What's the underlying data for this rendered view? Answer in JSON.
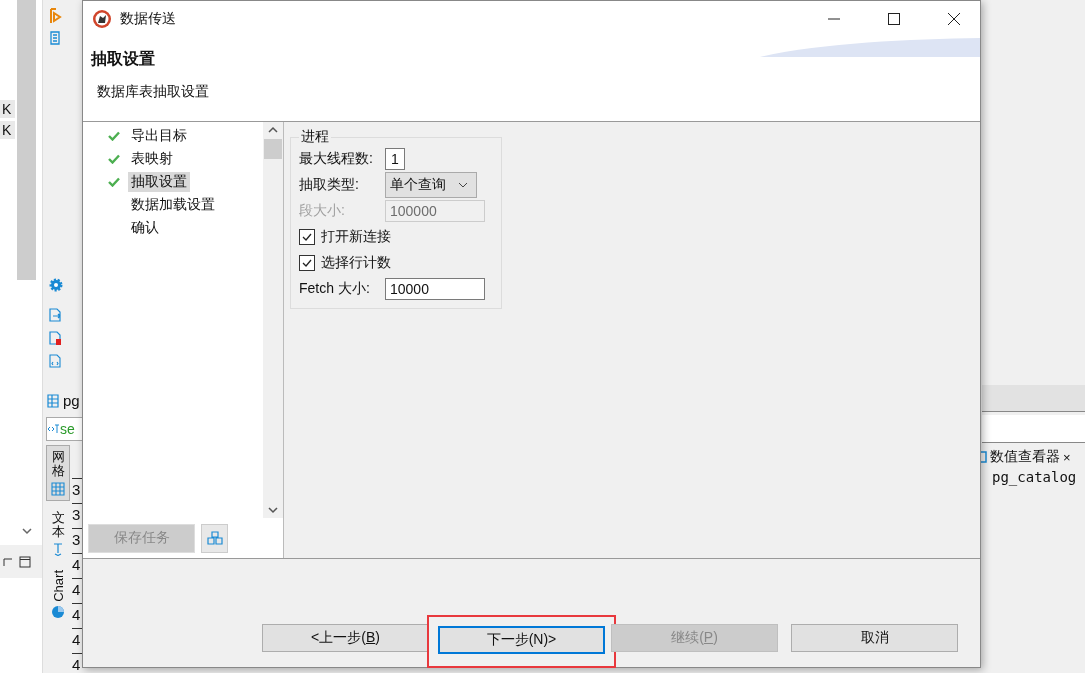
{
  "background": {
    "left_cells": [
      "K",
      "K"
    ],
    "editor_tab": "pg",
    "sql_field": "se",
    "view_tabs": [
      {
        "label": "网格",
        "kind": "grid",
        "selected": true
      },
      {
        "label": "文本",
        "kind": "text",
        "selected": false
      },
      {
        "label": "Chart",
        "kind": "chart",
        "selected": false
      }
    ],
    "row_numbers": [
      "3",
      "3",
      "3",
      "4",
      "4",
      "4",
      "4",
      "4"
    ],
    "side_panel": {
      "tab": "数值查看器",
      "close": "×",
      "value": "pg_catalog"
    }
  },
  "window": {
    "title": "数据传送"
  },
  "header": {
    "title": "抽取设置",
    "subtitle": "数据库表抽取设置"
  },
  "steps": [
    {
      "label": "导出目标",
      "done": true,
      "selected": false
    },
    {
      "label": "表映射",
      "done": true,
      "selected": false
    },
    {
      "label": "抽取设置",
      "done": true,
      "selected": true
    },
    {
      "label": "数据加载设置",
      "done": false,
      "selected": false
    },
    {
      "label": "确认",
      "done": false,
      "selected": false
    }
  ],
  "save_task": {
    "label": "保存任务",
    "disabled": true
  },
  "group": {
    "title": "进程",
    "fields": [
      {
        "kind": "short",
        "label": "最大线程数:",
        "value": "1"
      },
      {
        "kind": "select",
        "label": "抽取类型:",
        "value": "单个查询"
      },
      {
        "kind": "text",
        "label": "段大小:",
        "value": "100000",
        "disabled": true
      },
      {
        "kind": "checkbox",
        "label": "打开新连接",
        "checked": true
      },
      {
        "kind": "checkbox",
        "label": "选择行计数",
        "checked": true
      },
      {
        "kind": "text",
        "label": "Fetch 大小:",
        "value": "10000"
      }
    ]
  },
  "buttons": [
    {
      "before": "<上一步(",
      "mnemonic": "B",
      "after": ")",
      "disabled": false,
      "focused": false,
      "highlighted": false
    },
    {
      "before": "下一步(N)>",
      "disabled": false,
      "focused": true,
      "highlighted": true
    },
    {
      "before": "继续(",
      "mnemonic": "P",
      "after": ")",
      "disabled": true,
      "focused": false,
      "highlighted": false
    },
    {
      "before": "取消",
      "disabled": false,
      "focused": false,
      "highlighted": false
    }
  ]
}
